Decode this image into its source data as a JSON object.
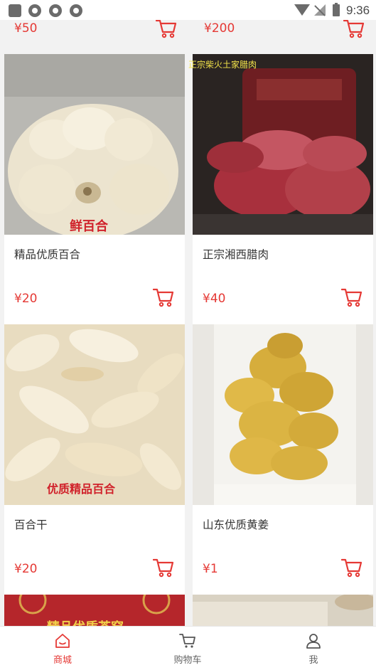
{
  "status_bar": {
    "time": "9:36"
  },
  "colors": {
    "accent": "#e53935",
    "icon_gray": "#555555"
  },
  "top_row_partial": [
    {
      "price": "¥50"
    },
    {
      "price": "¥200"
    }
  ],
  "products": [
    {
      "name": "精品优质百合",
      "price": "¥20",
      "image_caption": "鲜百合"
    },
    {
      "name": "正宗湘西腊肉",
      "price": "¥40",
      "image_caption": "正宗柴火土家腊肉"
    },
    {
      "name": "百合干",
      "price": "¥20",
      "image_caption": "优质精品百合"
    },
    {
      "name": "山东优质黄姜",
      "price": "¥1",
      "image_caption": ""
    }
  ],
  "bottom_row_partial": [
    {
      "image_caption": "精品优质茶窑"
    },
    {
      "image_caption": ""
    }
  ],
  "tabbar": {
    "tabs": [
      {
        "label": "商城",
        "icon": "home-icon",
        "active": true
      },
      {
        "label": "购物车",
        "icon": "cart-icon",
        "active": false
      },
      {
        "label": "我",
        "icon": "user-icon",
        "active": false
      }
    ]
  }
}
